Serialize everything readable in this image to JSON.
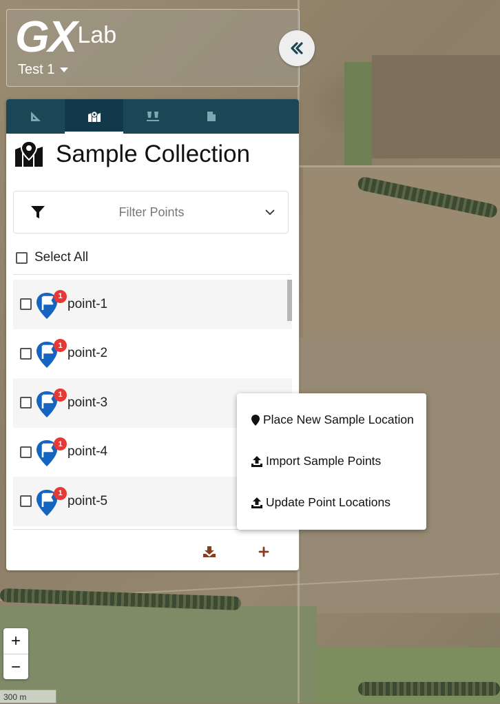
{
  "header": {
    "logo_main": "GX",
    "logo_sub": "Lab",
    "project": "Test 1"
  },
  "tabs": [
    {
      "name": "measure-icon",
      "active": false
    },
    {
      "name": "map-marker-icon",
      "active": true
    },
    {
      "name": "lab-beakers-icon",
      "active": false
    },
    {
      "name": "document-icon",
      "active": false
    }
  ],
  "panel": {
    "title": "Sample Collection",
    "filter_label": "Filter Points",
    "select_all_label": "Select All"
  },
  "points": [
    {
      "label": "point-1",
      "badge": "1"
    },
    {
      "label": "point-2",
      "badge": "1"
    },
    {
      "label": "point-3",
      "badge": "1"
    },
    {
      "label": "point-4",
      "badge": "1"
    },
    {
      "label": "point-5",
      "badge": "1"
    }
  ],
  "menu": {
    "place": "Place New Sample Location",
    "import": "Import Sample Points",
    "update": "Update Point Locations"
  },
  "map": {
    "zoom_in": "+",
    "zoom_out": "−",
    "scale": "300 m"
  },
  "colors": {
    "tab_bar": "#1a4656",
    "pin_blue": "#1565c0",
    "badge_red": "#e53935",
    "action_brown": "#8b3a1e"
  }
}
